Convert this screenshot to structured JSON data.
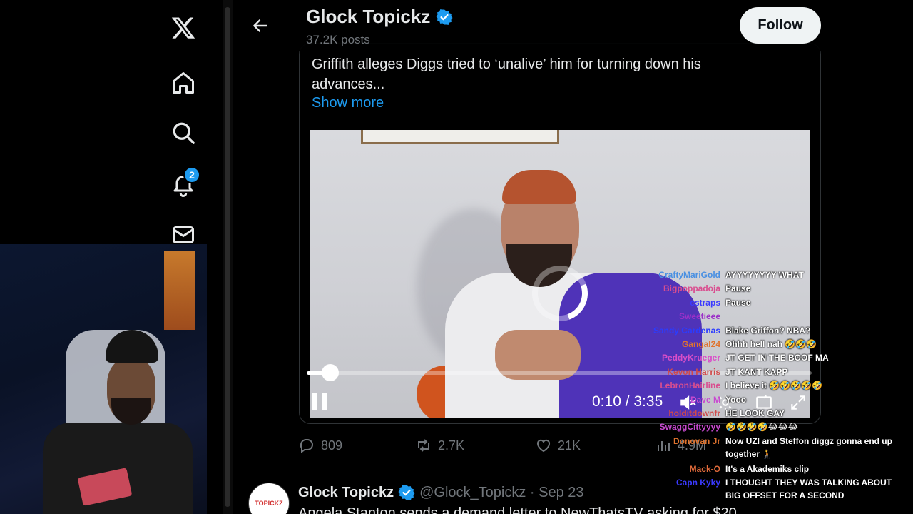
{
  "leftnav": {
    "notification_count": "2",
    "icons": [
      "x-logo-icon",
      "home-icon",
      "search-icon",
      "bell-icon",
      "mail-icon"
    ]
  },
  "header": {
    "name": "Glock Topickz",
    "posts": "37.2K posts",
    "follow_label": "Follow"
  },
  "post": {
    "text": "Griffith alleges Diggs tried to ‘unalive’ him for turning down his advances...",
    "show_more": "Show more",
    "video": {
      "current_time": "0:10",
      "duration": "3:35",
      "time_display": "0:10 / 3:35",
      "progress": 0.046
    },
    "stats": {
      "replies": "809",
      "reposts": "2.7K",
      "likes": "21K",
      "views": "4.9M"
    }
  },
  "next_post": {
    "avatar_text": "TOPICKZ",
    "name": "Glock Topickz",
    "handle_date": "@Glock_Topickz · Sep 23",
    "text": "Angela Stanton sends a demand letter to NewThatsTV asking for $20"
  },
  "chat": [
    {
      "user": "CraftyMariGold",
      "color": "#4a90e2",
      "msg": "AYYYYYYYY WHAT"
    },
    {
      "user": "Bigpoppadoja",
      "color": "#d94e8f",
      "msg": "Pause"
    },
    {
      "user": "cstraps",
      "color": "#3a3aff",
      "msg": "Pause"
    },
    {
      "user": "Sweetieee",
      "color": "#9b30c8",
      "msg": ""
    },
    {
      "user": "Sandy Cardenas",
      "color": "#2b3cff",
      "msg": "Blake Griffon? NBA?"
    },
    {
      "user": "Gangal24",
      "color": "#e0732e",
      "msg": "Ohhh hell nah 🤣🤣🤣"
    },
    {
      "user": "PeddyKrueger",
      "color": "#d94ec8",
      "msg": "JT GET IN THE BOOF MA"
    },
    {
      "user": "Kevon Harris",
      "color": "#d04a4a",
      "msg": "JT KANT KAPP"
    },
    {
      "user": "LebronHairline",
      "color": "#d94e8f",
      "msg": "I believe it 🤣🤣🤣🤣🤣"
    },
    {
      "user": "Dave M",
      "color": "#c84ad0",
      "msg": "Yooo"
    },
    {
      "user": "holditdownfr",
      "color": "#d04a4a",
      "msg": "HE LOOK GAY"
    },
    {
      "user": "SwaggCittyyyy",
      "color": "#c84ad0",
      "msg": "🤣🤣🤣🤣😂😂😂"
    },
    {
      "user": "Donovan Jr",
      "color": "#e0732e",
      "msg": "Now UZI and Steffon diggz gonna end up together 🧎"
    },
    {
      "user": "Mack-O",
      "color": "#e06a3a",
      "msg": "It's a Akademiks clip"
    },
    {
      "user": "Capn Kyky",
      "color": "#3a3aff",
      "msg": "I THOUGHT THEY WAS TALKING ABOUT BIG OFFSET FOR A SECOND"
    }
  ]
}
